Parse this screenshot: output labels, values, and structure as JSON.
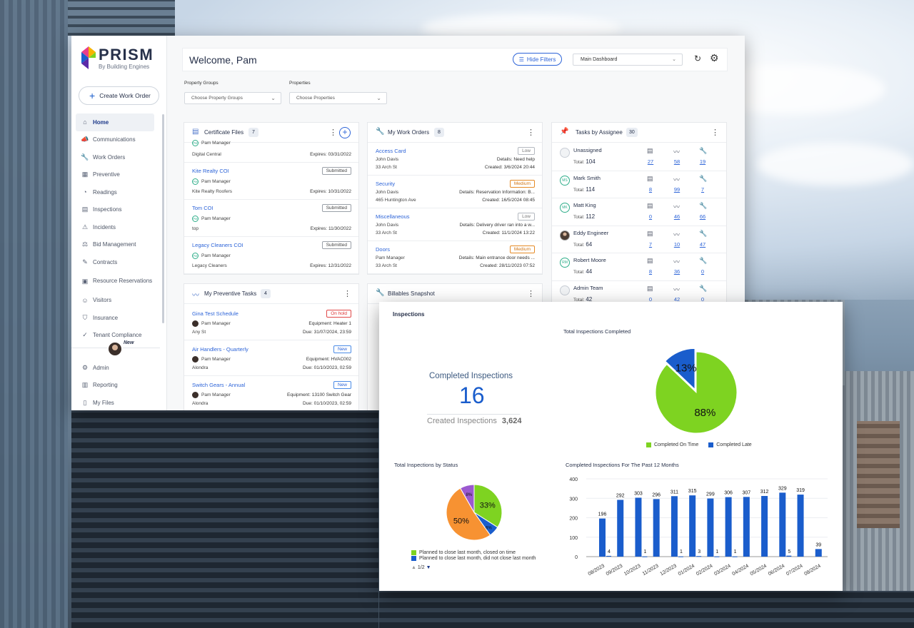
{
  "brand": {
    "name": "PRISM",
    "tagline": "By Building Engines"
  },
  "sidebar": {
    "create_label": "Create Work Order",
    "items": [
      {
        "label": "Home",
        "icon": "home-icon"
      },
      {
        "label": "Communications",
        "icon": "megaphone-icon"
      },
      {
        "label": "Work Orders",
        "icon": "wrench-icon"
      },
      {
        "label": "Preventive",
        "icon": "calendar-icon"
      },
      {
        "label": "Readings",
        "icon": "gauge-icon"
      },
      {
        "label": "Inspections",
        "icon": "clipboard-icon"
      },
      {
        "label": "Incidents",
        "icon": "alert-icon"
      },
      {
        "label": "Bid Management",
        "icon": "gavel-icon"
      },
      {
        "label": "Contracts",
        "icon": "contract-icon"
      },
      {
        "label": "Resource Reservations",
        "icon": "reservation-icon"
      },
      {
        "label": "Visitors",
        "icon": "visitor-icon"
      },
      {
        "label": "Insurance",
        "icon": "shield-icon"
      },
      {
        "label": "Tenant Compliance",
        "icon": "check-circle-icon"
      }
    ],
    "new_badge": "New",
    "bottom_items": [
      {
        "label": "Admin",
        "icon": "gear-icon"
      },
      {
        "label": "Reporting",
        "icon": "report-icon"
      },
      {
        "label": "My Files",
        "icon": "file-icon"
      }
    ]
  },
  "header": {
    "welcome": "Welcome, Pam",
    "hide_filters": "Hide Filters",
    "dashboard_select": "Main Dashboard"
  },
  "filters": {
    "property_groups_label": "Property Groups",
    "property_groups_placeholder": "Choose Property Groups",
    "properties_label": "Properties",
    "properties_placeholder": "Choose Properties"
  },
  "certificate_files": {
    "title": "Certificate Files",
    "count": "7",
    "rows": [
      {
        "partial_name": "Pam Manager",
        "company": "Digital Central",
        "expires": "Expires: 03/31/2022"
      },
      {
        "title": "Kite Realty COI",
        "status": "Submitted",
        "manager": "Pam Manager",
        "company": "Kite Realty Roofers",
        "expires": "Expires: 10/31/2022"
      },
      {
        "title": "Tom COI",
        "status": "Submitted",
        "manager": "Pam Manager",
        "company": "top",
        "expires": "Expires: 11/30/2022"
      },
      {
        "title": "Legacy Cleaners COI",
        "status": "Submitted",
        "manager": "Pam Manager",
        "company": "Legacy Cleaners",
        "expires": "Expires: 12/31/2022"
      }
    ]
  },
  "work_orders": {
    "title": "My Work Orders",
    "count": "8",
    "rows": [
      {
        "title": "Access Card",
        "priority": "Low",
        "person": "John Davis",
        "details": "Details: Need help",
        "address": "33 Arch St",
        "created": "Created: 3/6/2024 20:44"
      },
      {
        "title": "Security",
        "priority": "Medium",
        "person": "John Davis",
        "details": "Details: Reservation Information: B...",
        "address": "465 Huntington Ave",
        "created": "Created: 16/5/2024 08:45"
      },
      {
        "title": "Miscellaneous",
        "priority": "Low",
        "person": "John Davis",
        "details": "Details: Delivery driver ran into a w...",
        "address": "33 Arch St",
        "created": "Created: 11/1/2024 13:22"
      },
      {
        "title": "Doors",
        "priority": "Medium",
        "person": "Pam Manager",
        "details": "Details: Main entrance door needs ...",
        "address": "33 Arch St",
        "created": "Created: 28/11/2023 07:52"
      }
    ]
  },
  "tasks_by_assignee": {
    "title": "Tasks by Assignee",
    "count": "30",
    "rows": [
      {
        "initials": "",
        "avatar": "blank",
        "name": "Unassigned",
        "total_label": "Total:",
        "total": "104",
        "a": "27",
        "b": "58",
        "c": "19"
      },
      {
        "initials": "MS",
        "avatar": "initials",
        "name": "Mark Smith",
        "total_label": "Total:",
        "total": "114",
        "a": "8",
        "b": "99",
        "c": "7"
      },
      {
        "initials": "MK",
        "avatar": "initials",
        "name": "Matt King",
        "total_label": "Total:",
        "total": "112",
        "a": "0",
        "b": "46",
        "c": "66"
      },
      {
        "initials": "",
        "avatar": "photo",
        "name": "Eddy Engineer",
        "total_label": "Total:",
        "total": "64",
        "a": "7",
        "b": "10",
        "c": "47"
      },
      {
        "initials": "RM",
        "avatar": "initials",
        "name": "Robert Moore",
        "total_label": "Total:",
        "total": "44",
        "a": "8",
        "b": "36",
        "c": "0"
      },
      {
        "initials": "",
        "avatar": "blank",
        "name": "Admin Team",
        "total_label": "Total:",
        "total": "42",
        "a": "0",
        "b": "42",
        "c": "0"
      }
    ]
  },
  "preventive_tasks": {
    "title": "My Preventive Tasks",
    "count": "4",
    "rows": [
      {
        "title": "Gina Test Schedule",
        "status": "On hold",
        "manager": "Pam Manager",
        "equipment": "Equipment: Heater 1",
        "address": "Any St",
        "due": "Due: 31/07/2024, 23:59"
      },
      {
        "title": "Air Handlers - Quarterly",
        "status": "New",
        "manager": "Pam Manager",
        "equipment": "Equipment: HVAC002",
        "address": "Alondra",
        "due": "Due: 01/10/2023, 02:59"
      },
      {
        "title": "Switch Gears - Annual",
        "status": "New",
        "manager": "Pam Manager",
        "equipment": "Equipment: 13100 Switch Gear",
        "address": "Alondra",
        "due": "Due: 01/10/2023, 02:59"
      }
    ]
  },
  "billables": {
    "title": "Billables Snapshot"
  },
  "inspections": {
    "title": "Inspections",
    "completed_label": "Completed Inspections",
    "completed_value": "16",
    "created_label": "Created Inspections",
    "created_value": "3,624",
    "pie_title": "Total Inspections Completed",
    "status_title": "Total Inspections by Status",
    "bar_title": "Completed Inspections For The Past 12 Months",
    "status_legend": [
      {
        "label": "Planned to close last month, closed on time",
        "color": "#7ed321"
      },
      {
        "label": "Planned to close last month, did not close last month",
        "color": "#1a5dcc"
      }
    ],
    "status_pager": "1/2"
  },
  "colors": {
    "accent": "#1a5dcc",
    "green": "#7ed321",
    "orange": "#f79232",
    "purple": "#9b59d0"
  },
  "chart_data": [
    {
      "type": "pie",
      "title": "Total Inspections Completed",
      "labels": [
        "Completed On Time",
        "Completed Late"
      ],
      "values": [
        88,
        13
      ],
      "value_labels": [
        "88%",
        "13%"
      ],
      "colors": [
        "#7ed321",
        "#1a5dcc"
      ],
      "legend": "bottom"
    },
    {
      "type": "pie",
      "title": "Total Inspections by Status",
      "values": [
        33,
        6,
        50,
        8
      ],
      "value_labels": [
        "33%",
        "6%",
        "50%",
        "8%"
      ],
      "colors": [
        "#7ed321",
        "#1a5dcc",
        "#f79232",
        "#9b59d0"
      ],
      "legend": "bottom"
    },
    {
      "type": "bar",
      "title": "Completed Inspections For The Past 12 Months",
      "categories": [
        "08/2023",
        "09/2023",
        "10/2023",
        "11/2023",
        "12/2023",
        "01/2024",
        "02/2024",
        "03/2024",
        "04/2024",
        "05/2024",
        "06/2024",
        "07/2024",
        "08/2024"
      ],
      "series": [
        {
          "values": [
            196,
            292,
            303,
            296,
            311,
            315,
            299,
            306,
            307,
            312,
            329,
            319,
            39
          ],
          "color": "#1a5dcc"
        },
        {
          "values": [
            4,
            0,
            1,
            0,
            1,
            3,
            1,
            1,
            0,
            0,
            5,
            0,
            0
          ],
          "color": "#1a5dcc"
        }
      ],
      "value_labels_secondary": [
        "4",
        "",
        "1",
        "",
        "1",
        "3",
        "1",
        "1",
        "",
        "",
        "5",
        "",
        ""
      ],
      "yticks": [
        "400",
        "300",
        "200",
        "100",
        "0"
      ],
      "ylim": [
        0,
        400
      ]
    }
  ]
}
